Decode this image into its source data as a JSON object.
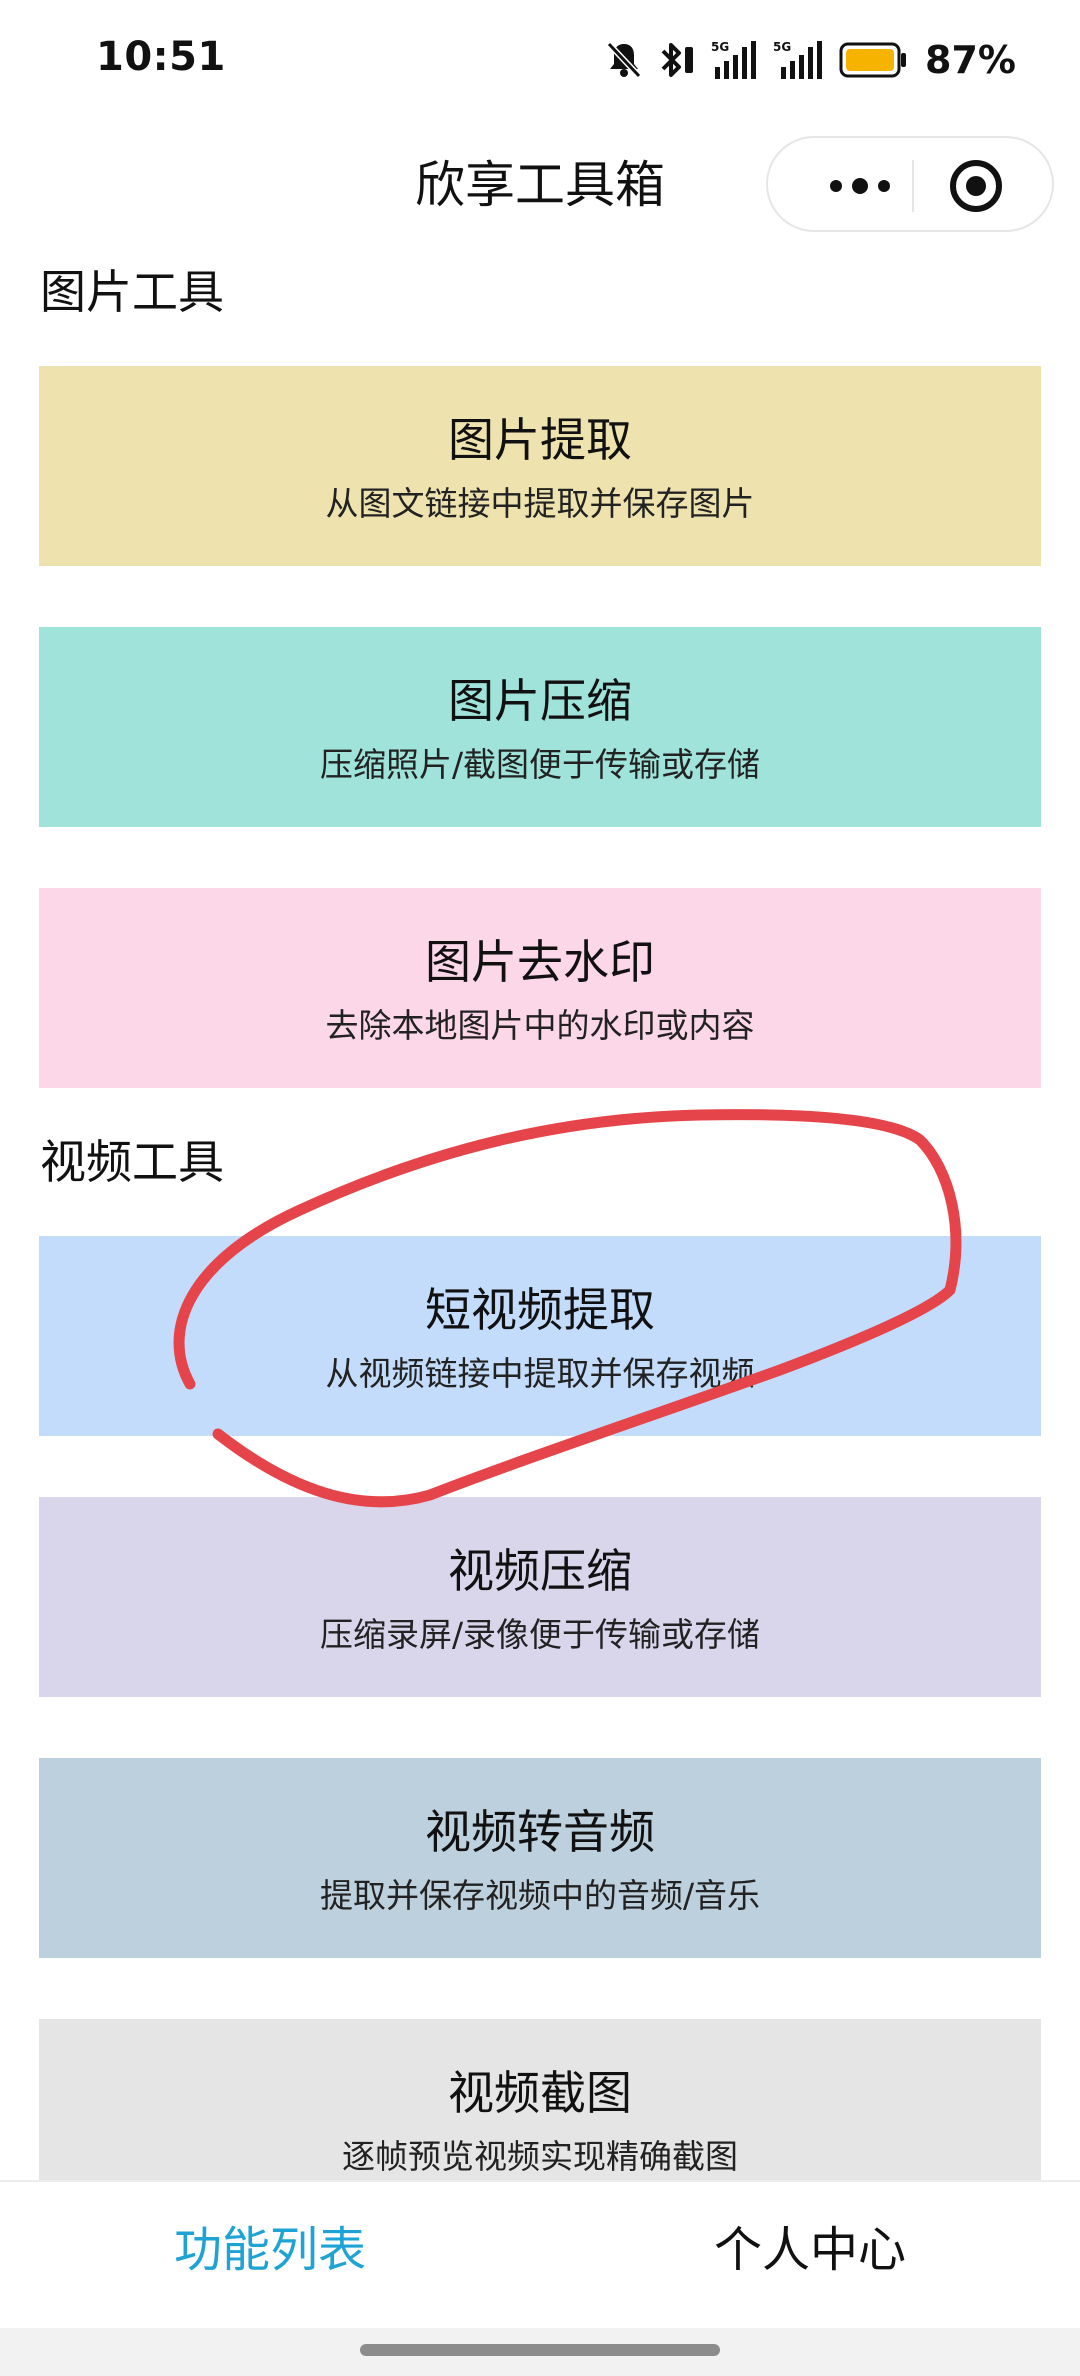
{
  "status_bar": {
    "time": "10:51",
    "battery_percent": "87%",
    "icons": [
      "mute-bell-icon",
      "bluetooth-icon",
      "signal-5g-icon",
      "signal-5g-icon",
      "battery-icon"
    ],
    "signal_1_label": "5G",
    "signal_2_label": "5G"
  },
  "header": {
    "title": "欣享工具箱",
    "more_icon": "more-dots-icon",
    "target_icon": "target-icon"
  },
  "sections": {
    "image_tools": {
      "title": "图片工具",
      "cards": [
        {
          "title": "图片提取",
          "desc": "从图文链接中提取并保存图片",
          "color": "#eee3ae"
        },
        {
          "title": "图片压缩",
          "desc": "压缩照片/截图便于传输或存储",
          "color": "#9fe3da"
        },
        {
          "title": "图片去水印",
          "desc": "去除本地图片中的水印或内容",
          "color": "#fcd7e8"
        }
      ]
    },
    "video_tools": {
      "title": "视频工具",
      "cards": [
        {
          "title": "短视频提取",
          "desc": "从视频链接中提取并保存视频",
          "color": "#c3dcfb"
        },
        {
          "title": "视频压缩",
          "desc": "压缩录屏/录像便于传输或存储",
          "color": "#d9d6ec"
        },
        {
          "title": "视频转音频",
          "desc": "提取并保存视频中的音频/音乐",
          "color": "#bdd0dd"
        },
        {
          "title": "视频截图",
          "desc": "逐帧预览视频实现精确截图",
          "color": "#e5e5e5"
        }
      ]
    }
  },
  "annotation": {
    "color": "#e5454a"
  },
  "tabbar": {
    "tabs": [
      {
        "label": "功能列表",
        "active": true,
        "color": "#1fa3d4"
      },
      {
        "label": "个人中心",
        "active": false,
        "color": "#111111"
      }
    ]
  }
}
